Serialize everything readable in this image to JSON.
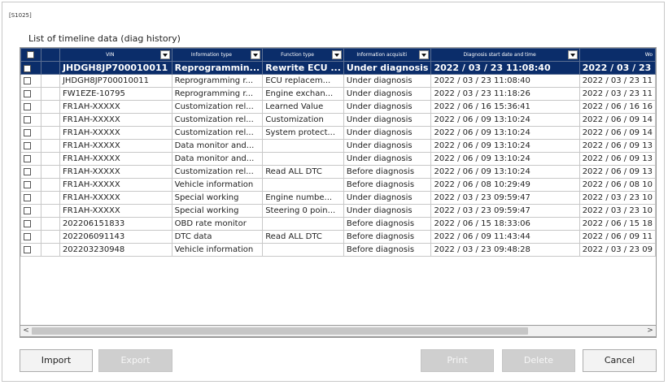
{
  "screen_id": "[S1025]",
  "title": "List of timeline data (diag history)",
  "columns": [
    {
      "key": "vin",
      "label": "VIN"
    },
    {
      "key": "info_type",
      "label": "Information type"
    },
    {
      "key": "func_type",
      "label": "Function type"
    },
    {
      "key": "acq",
      "label": "Information acquisiti"
    },
    {
      "key": "start",
      "label": "Diagnosis start date and time"
    },
    {
      "key": "w",
      "label": "Wo"
    }
  ],
  "rows": [
    {
      "vin": "JHDGH8JP700010011",
      "info_type": "Reprogrammin...",
      "func_type": "Rewrite ECU ...",
      "acq": "Under diagnosis",
      "start": "2022 / 03 / 23 11:08:40",
      "w": "2022 / 03 / 23",
      "selected": true
    },
    {
      "vin": "JHDGH8JP700010011",
      "info_type": "Reprogramming r...",
      "func_type": "ECU replacem...",
      "acq": "Under diagnosis",
      "start": "2022 / 03 / 23 11:08:40",
      "w": "2022 / 03 / 23 11"
    },
    {
      "vin": "FW1EZE-10795",
      "info_type": "Reprogramming r...",
      "func_type": "Engine exchan...",
      "acq": "Under diagnosis",
      "start": "2022 / 03 / 23 11:18:26",
      "w": "2022 / 03 / 23 11"
    },
    {
      "vin": "FR1AH-XXXXX",
      "info_type": "Customization rel...",
      "func_type": "Learned Value",
      "acq": "Under diagnosis",
      "start": "2022 / 06 / 16 15:36:41",
      "w": "2022 / 06 / 16 16"
    },
    {
      "vin": "FR1AH-XXXXX",
      "info_type": "Customization rel...",
      "func_type": "Customization",
      "acq": "Under diagnosis",
      "start": "2022 / 06 / 09 13:10:24",
      "w": "2022 / 06 / 09 14"
    },
    {
      "vin": "FR1AH-XXXXX",
      "info_type": "Customization rel...",
      "func_type": "System protect...",
      "acq": "Under diagnosis",
      "start": "2022 / 06 / 09 13:10:24",
      "w": "2022 / 06 / 09 14"
    },
    {
      "vin": "FR1AH-XXXXX",
      "info_type": "Data monitor and...",
      "func_type": "",
      "acq": "Under diagnosis",
      "start": "2022 / 06 / 09 13:10:24",
      "w": "2022 / 06 / 09 13"
    },
    {
      "vin": "FR1AH-XXXXX",
      "info_type": "Data monitor and...",
      "func_type": "",
      "acq": "Under diagnosis",
      "start": "2022 / 06 / 09 13:10:24",
      "w": "2022 / 06 / 09 13"
    },
    {
      "vin": "FR1AH-XXXXX",
      "info_type": "Customization rel...",
      "func_type": "Read ALL DTC",
      "acq": "Before diagnosis",
      "start": "2022 / 06 / 09 13:10:24",
      "w": "2022 / 06 / 09 13"
    },
    {
      "vin": "FR1AH-XXXXX",
      "info_type": "Vehicle information",
      "func_type": "",
      "acq": "Before diagnosis",
      "start": "2022 / 06 / 08 10:29:49",
      "w": "2022 / 06 / 08 10"
    },
    {
      "vin": "FR1AH-XXXXX",
      "info_type": "Special working",
      "func_type": "Engine numbe...",
      "acq": "Under diagnosis",
      "start": "2022 / 03 / 23 09:59:47",
      "w": "2022 / 03 / 23 10"
    },
    {
      "vin": "FR1AH-XXXXX",
      "info_type": "Special working",
      "func_type": "Steering 0 poin...",
      "acq": "Under diagnosis",
      "start": "2022 / 03 / 23 09:59:47",
      "w": "2022 / 03 / 23 10"
    },
    {
      "vin": "202206151833",
      "info_type": "OBD rate monitor",
      "func_type": "",
      "acq": "Before diagnosis",
      "start": "2022 / 06 / 15 18:33:06",
      "w": "2022 / 06 / 15 18"
    },
    {
      "vin": "202206091143",
      "info_type": "DTC data",
      "func_type": "Read ALL DTC",
      "acq": "Before diagnosis",
      "start": "2022 / 06 / 09 11:43:44",
      "w": "2022 / 06 / 09 11"
    },
    {
      "vin": "202203230948",
      "info_type": "Vehicle information",
      "func_type": "",
      "acq": "Before diagnosis",
      "start": "2022 / 03 / 23 09:48:28",
      "w": "2022 / 03 / 23 09"
    }
  ],
  "scrollbar": {
    "left_arrow": "<",
    "right_arrow": ">"
  },
  "buttons": {
    "import": "Import",
    "export": "Export",
    "print": "Print",
    "delete": "Delete",
    "cancel": "Cancel"
  }
}
